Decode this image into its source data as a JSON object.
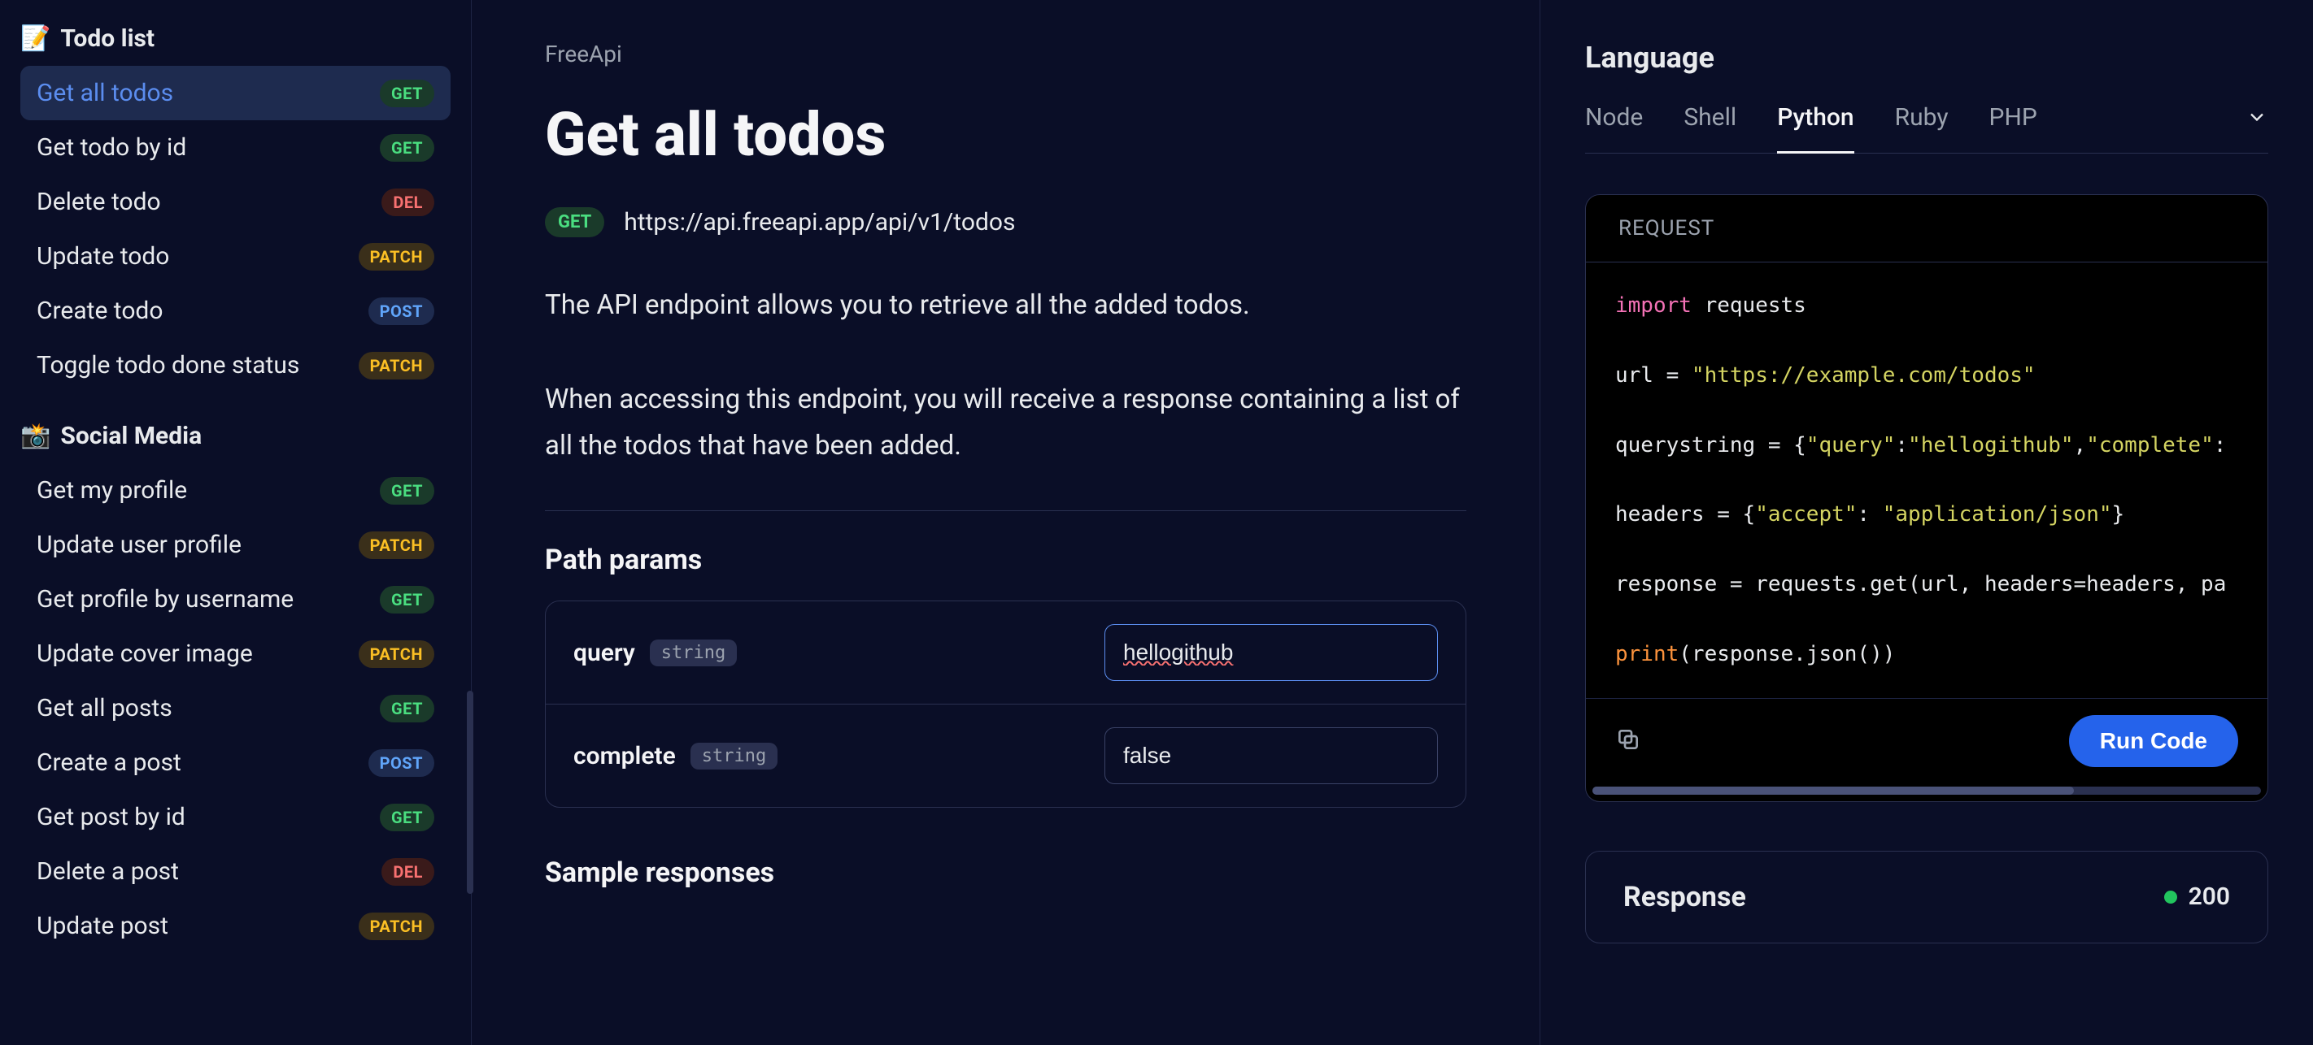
{
  "sidebar": {
    "groups": [
      {
        "icon": "📝",
        "title": "Todo list",
        "items": [
          {
            "label": "Get all todos",
            "method": "GET",
            "active": true
          },
          {
            "label": "Get todo by id",
            "method": "GET"
          },
          {
            "label": "Delete todo",
            "method": "DEL"
          },
          {
            "label": "Update todo",
            "method": "PATCH"
          },
          {
            "label": "Create todo",
            "method": "POST"
          },
          {
            "label": "Toggle todo done status",
            "method": "PATCH"
          }
        ]
      },
      {
        "icon": "📸",
        "title": "Social Media",
        "items": [
          {
            "label": "Get my profile",
            "method": "GET"
          },
          {
            "label": "Update user profile",
            "method": "PATCH"
          },
          {
            "label": "Get profile by username",
            "method": "GET"
          },
          {
            "label": "Update cover image",
            "method": "PATCH"
          },
          {
            "label": "Get all posts",
            "method": "GET"
          },
          {
            "label": "Create a post",
            "method": "POST"
          },
          {
            "label": "Get post by id",
            "method": "GET"
          },
          {
            "label": "Delete a post",
            "method": "DEL"
          },
          {
            "label": "Update post",
            "method": "PATCH"
          }
        ]
      }
    ]
  },
  "main": {
    "breadcrumb": "FreeApi",
    "title": "Get all todos",
    "method": "GET",
    "url": "https://api.freeapi.app/api/v1/todos",
    "description_p1": "The API endpoint allows you to retrieve all the added todos.",
    "description_p2": "When accessing this endpoint, you will receive a response containing a list of all the todos that have been added.",
    "params_heading": "Path params",
    "params": [
      {
        "name": "query",
        "type": "string",
        "value": "hellogithub",
        "focused": true
      },
      {
        "name": "complete",
        "type": "string",
        "value": "false",
        "focused": false
      }
    ],
    "sample_responses_heading": "Sample responses"
  },
  "right": {
    "language_heading": "Language",
    "languages": [
      "Node",
      "Shell",
      "Python",
      "Ruby",
      "PHP"
    ],
    "active_language": "Python",
    "request_label": "REQUEST",
    "code": {
      "import_kw": "import",
      "import_mod": " requests",
      "url_line_a": "url = ",
      "url_line_b": "\"https://example.com/todos\"",
      "query_a": "querystring = {",
      "query_b": "\"query\"",
      "query_c": ":",
      "query_d": "\"hellogithub\"",
      "query_e": ",",
      "query_f": "\"complete\"",
      "query_g": ":",
      "headers_a": "headers = {",
      "headers_b": "\"accept\"",
      "headers_c": ": ",
      "headers_d": "\"application/json\"",
      "headers_e": "}",
      "resp_line": "response = requests.get(url, headers=headers, pa",
      "print_fn": "print",
      "print_rest": "(response.json())"
    },
    "run_label": "Run Code",
    "response_heading": "Response",
    "response_status": "200"
  }
}
